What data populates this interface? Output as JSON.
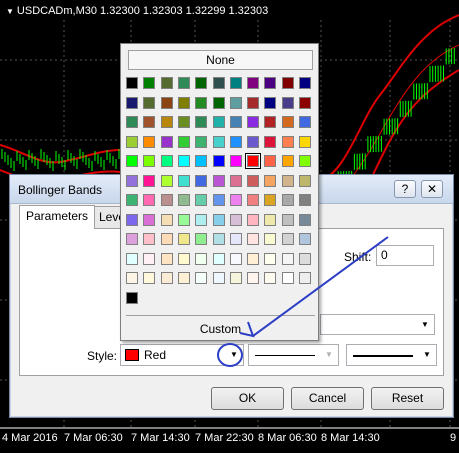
{
  "chart": {
    "title": "USDCADm,M30  1.32300 1.32303 1.32299 1.32303",
    "x_ticks": [
      "4 Mar 2016",
      "7 Mar 06:30",
      "7 Mar 14:30",
      "7 Mar 22:30",
      "8 Mar 06:30",
      "8 Mar 14:30",
      "9"
    ]
  },
  "dialog": {
    "title": "Bollinger Bands",
    "help_label": "?",
    "close_label": "✕",
    "tabs": [
      "Parameters",
      "Levels"
    ],
    "shift_label": "Shift:",
    "shift_value": "0",
    "style_label": "Style:",
    "style_color_name": "Red",
    "style_color": "#ff0000",
    "buttons": {
      "ok": "OK",
      "cancel": "Cancel",
      "reset": "Reset"
    }
  },
  "color_popup": {
    "none_label": "None",
    "custom_label": "Custom",
    "selected_color": "#ff0000",
    "swatch_rows": [
      [
        "#000000",
        "#008000",
        "#556b2f",
        "#2e8b57",
        "#006400",
        "#2f4f4f",
        "#008080",
        "#800080",
        "#4b0082",
        "#800000",
        "#000080"
      ],
      [
        "#191970",
        "#556b2f",
        "#8b4513",
        "#808000",
        "#228b22",
        "#006400",
        "#5f9ea0",
        "#a52a2a",
        "#000080",
        "#483d8b",
        "#8b0000"
      ],
      [
        "#2e8b57",
        "#a0522d",
        "#b8860b",
        "#6b8e23",
        "#2e8b57",
        "#20b2aa",
        "#4682b4",
        "#8a2be2",
        "#b22222",
        "#d2691e",
        "#4169e1"
      ],
      [
        "#9acd32",
        "#ff8c00",
        "#9932cc",
        "#32cd32",
        "#3cb371",
        "#48d1cc",
        "#1e90ff",
        "#6a5acd",
        "#dc143c",
        "#ff7f50",
        "#ffd700"
      ],
      [
        "#00ff00",
        "#7cfc00",
        "#00ff7f",
        "#00ffff",
        "#00bfff",
        "#0000ff",
        "#ff00ff",
        "#ff0000",
        "#ff6347",
        "#ffa500",
        "#7fff00"
      ],
      [
        "#9370db",
        "#ff1493",
        "#adff2f",
        "#40e0d0",
        "#4169e1",
        "#ba55d3",
        "#db7093",
        "#cd5c5c",
        "#f4a460",
        "#d2b48c",
        "#bdb76b"
      ],
      [
        "#3cb371",
        "#ff69b4",
        "#bc8f8f",
        "#8fbc8f",
        "#66cdaa",
        "#6495ed",
        "#ee82ee",
        "#f08080",
        "#daa520",
        "#a9a9a9",
        "#808080"
      ],
      [
        "#7b68ee",
        "#da70d6",
        "#f5deb3",
        "#98fb98",
        "#afeeee",
        "#87ceeb",
        "#d8bfd8",
        "#ffb6c1",
        "#eee8aa",
        "#c0c0c0",
        "#778899"
      ],
      [
        "#dda0dd",
        "#ffc0cb",
        "#ffdab9",
        "#f0e68c",
        "#90ee90",
        "#b0e0e6",
        "#e6e6fa",
        "#ffe4e1",
        "#fafad2",
        "#d3d3d3",
        "#b0c4de"
      ],
      [
        "#e0ffff",
        "#fff0f5",
        "#ffe4c4",
        "#fffacd",
        "#f0fff0",
        "#e0ffff",
        "#f8f8ff",
        "#ffefd5",
        "#fffff0",
        "#f5f5f5",
        "#dcdcdc"
      ],
      [
        "#fdf5e6",
        "#fff8dc",
        "#faebd7",
        "#ffefd5",
        "#f5fffa",
        "#f0f8ff",
        "#f5f5dc",
        "#fff5ee",
        "#fffaf0",
        "#ffffff",
        "#eeeeee"
      ],
      [
        "#000000"
      ]
    ]
  }
}
